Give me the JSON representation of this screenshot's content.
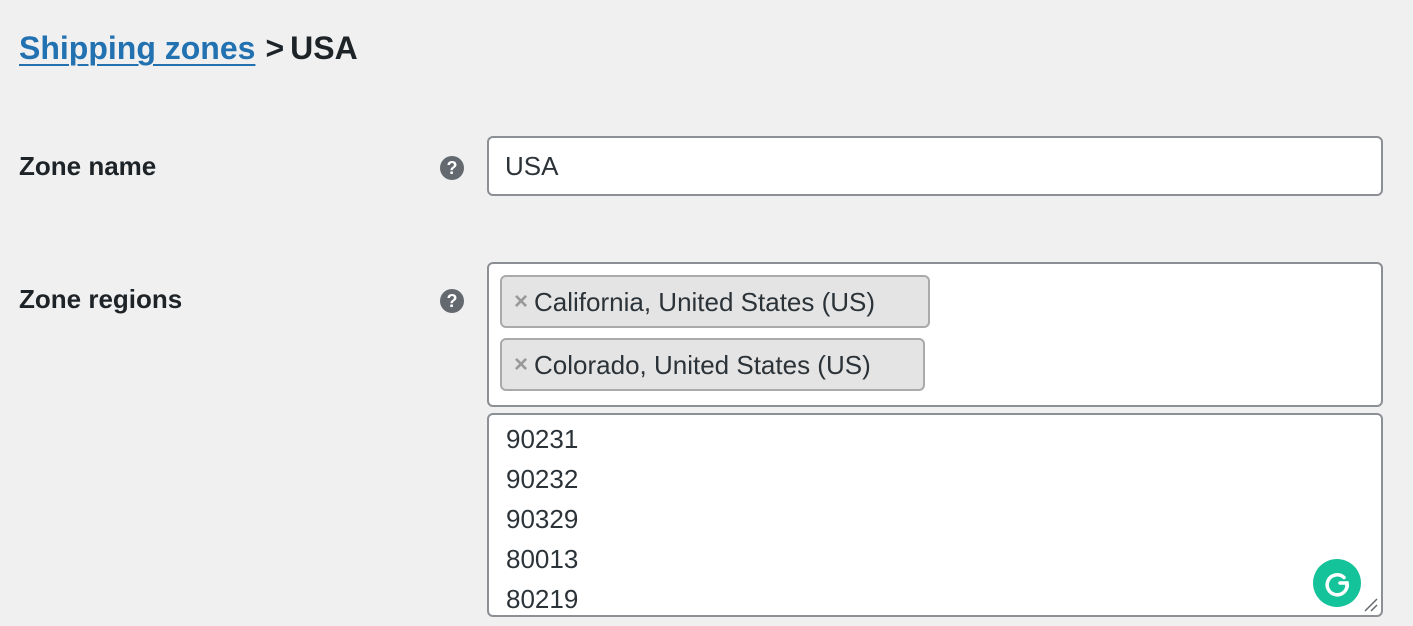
{
  "breadcrumb": {
    "link_label": "Shipping zones",
    "separator": ">",
    "current": "USA"
  },
  "zone_name": {
    "label": "Zone name",
    "help_icon": "question-circle-icon",
    "value": "USA"
  },
  "zone_regions": {
    "label": "Zone regions",
    "help_icon": "question-circle-icon",
    "tags": [
      {
        "remove_symbol": "×",
        "label": "California, United States (US)"
      },
      {
        "remove_symbol": "×",
        "label": "Colorado, United States (US)"
      }
    ]
  },
  "postcodes": {
    "lines": [
      "90231",
      "90232",
      "90329",
      "80013",
      "80219"
    ]
  },
  "colors": {
    "link": "#2271b1",
    "page_background": "#f0f0f1",
    "grammarly": "#15c39a"
  }
}
